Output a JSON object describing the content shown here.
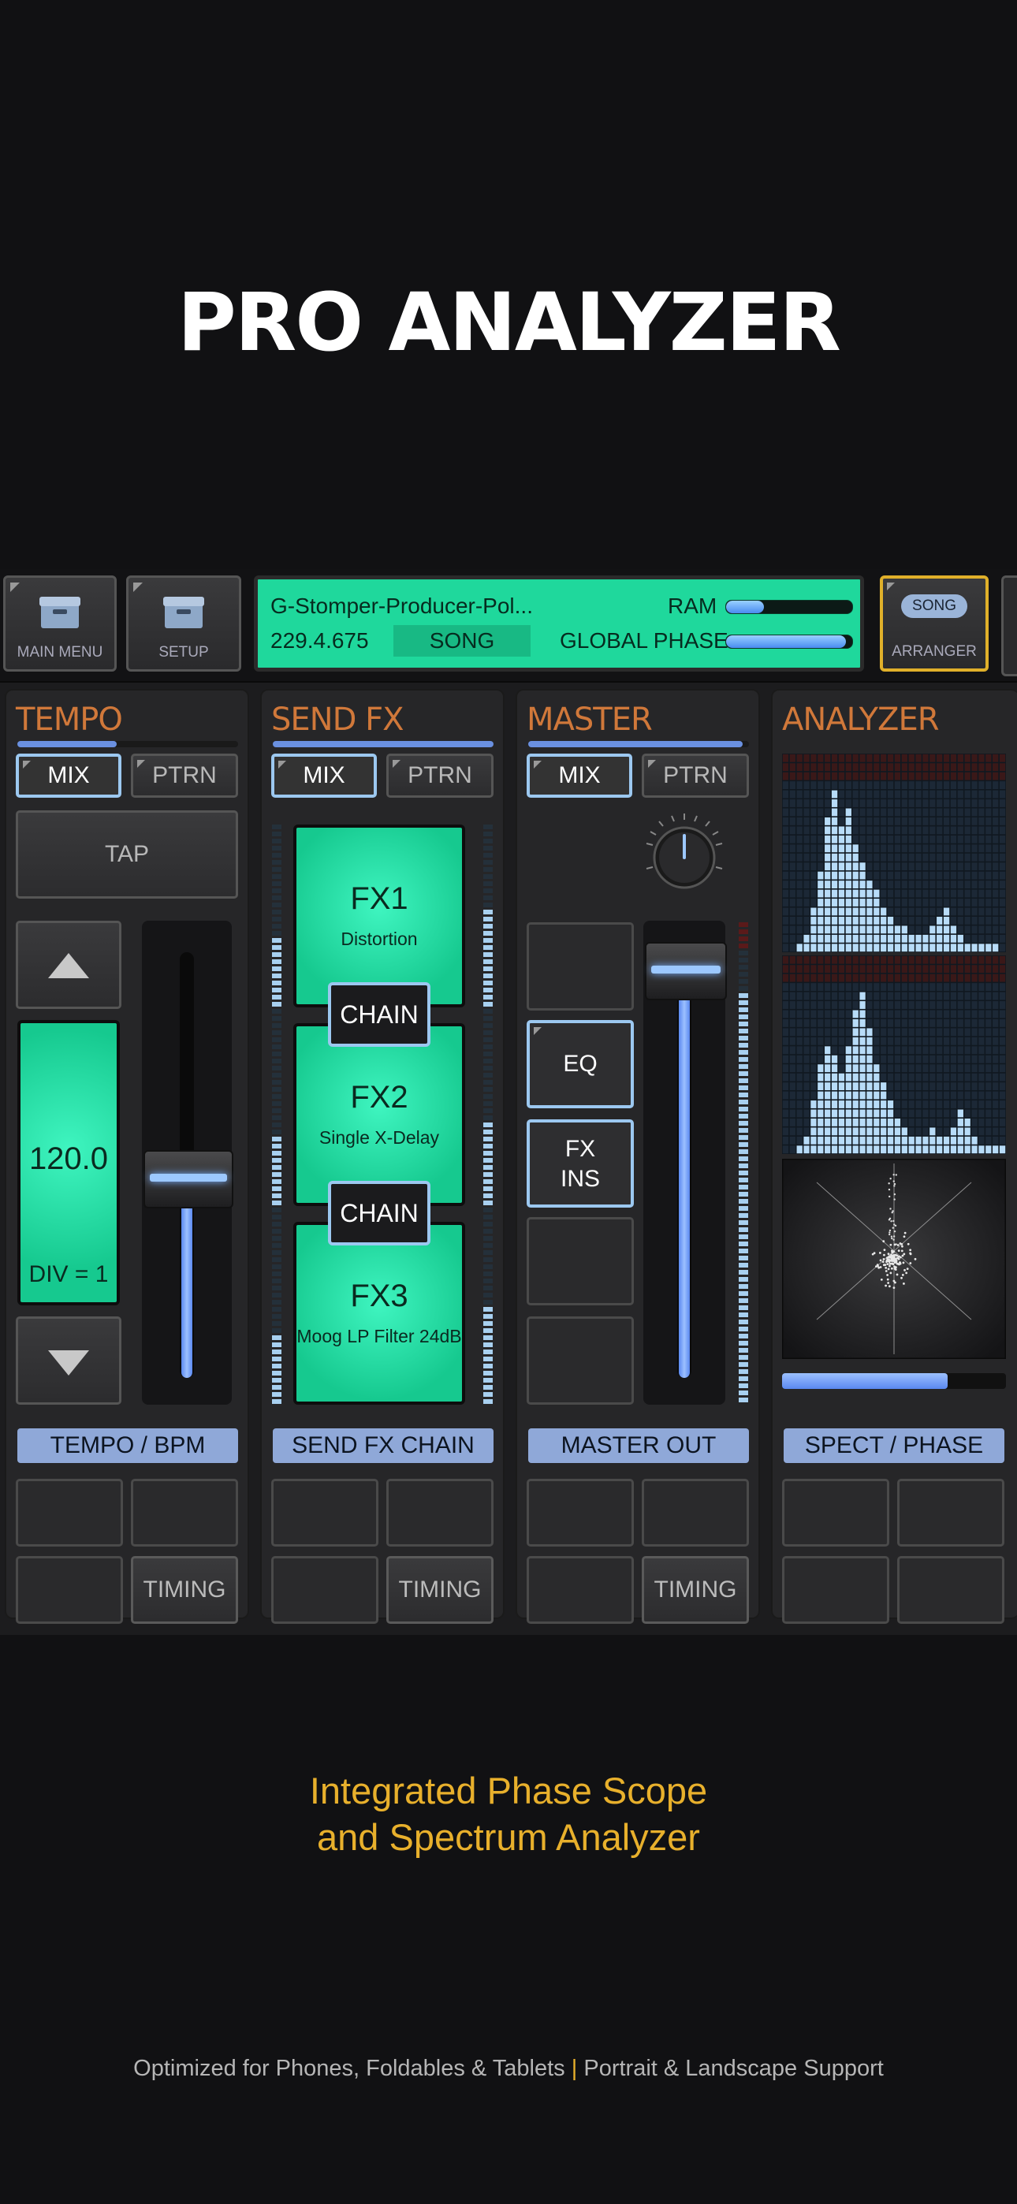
{
  "hero": {
    "title": "PRO ANALYZER"
  },
  "topbar": {
    "main_menu": "MAIN MENU",
    "setup": "SETUP",
    "song_name": "G-Stomper-Producer-Pol...",
    "position": "229.4.675",
    "mode": "SONG",
    "ram_label": "RAM",
    "ram_level": 0.3,
    "phase_label": "GLOBAL PHASE",
    "phase_level": 0.95,
    "arranger_pill": "SONG",
    "arranger": "ARRANGER"
  },
  "panels": {
    "tempo": {
      "title": "TEMPO",
      "mix": "MIX",
      "ptrn": "PTRN",
      "tap": "TAP",
      "bpm_value": "120.0",
      "div": "DIV = 1",
      "label": "TEMPO / BPM",
      "timing": "TIMING",
      "fader_level": 0.47
    },
    "sendfx": {
      "title": "SEND FX",
      "mix": "MIX",
      "ptrn": "PTRN",
      "fx": [
        {
          "name": "FX1",
          "effect": "Distortion"
        },
        {
          "name": "FX2",
          "effect": "Single X-Delay"
        },
        {
          "name": "FX3",
          "effect": "Moog LP Filter 24dB"
        }
      ],
      "chain": "CHAIN",
      "label": "SEND FX CHAIN",
      "timing": "TIMING"
    },
    "master": {
      "title": "MASTER",
      "mix": "MIX",
      "ptrn": "PTRN",
      "eq": "EQ",
      "fx_ins_1": "FX",
      "fx_ins_2": "INS",
      "label": "MASTER OUT",
      "timing": "TIMING",
      "fader_level": 0.96
    },
    "analyzer": {
      "title": "ANALYZER",
      "label": "SPECT / PHASE",
      "slider_level": 0.74,
      "spectrum_1": [
        0,
        0,
        1,
        2,
        5,
        9,
        15,
        18,
        14,
        16,
        12,
        10,
        8,
        7,
        5,
        4,
        3,
        3,
        2,
        2,
        2,
        3,
        4,
        5,
        3,
        2,
        1,
        1,
        1,
        1,
        1,
        0
      ],
      "spectrum_2": [
        0,
        0,
        1,
        2,
        6,
        10,
        12,
        11,
        9,
        12,
        16,
        18,
        14,
        10,
        8,
        6,
        4,
        3,
        2,
        2,
        2,
        3,
        2,
        2,
        3,
        5,
        4,
        2,
        1,
        1,
        1,
        1
      ]
    }
  },
  "tagline": {
    "line1": "Integrated Phase Scope",
    "line2": "and Spectrum Analyzer"
  },
  "footer": {
    "left": "Optimized for Phones, Foldables & Tablets",
    "sep": "|",
    "right": "Portrait & Landscape Support"
  },
  "colors": {
    "accent_orange": "#d0783a",
    "lcd_green": "#1fd89c",
    "tagline_gold": "#e8b02c",
    "highlight_blue": "#9cc8f0"
  }
}
